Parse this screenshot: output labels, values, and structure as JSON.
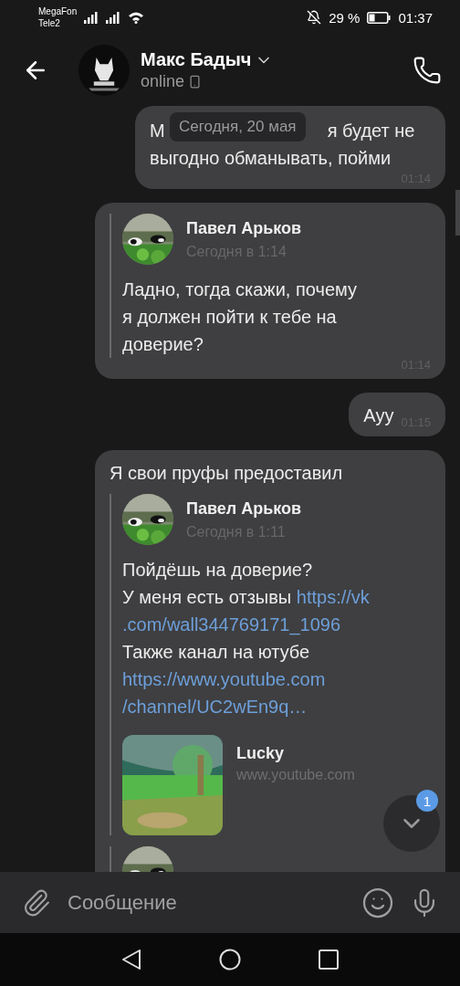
{
  "status_bar": {
    "carriers": [
      "MegaFon",
      "Tele2"
    ],
    "battery": "29 %",
    "time": "01:37"
  },
  "header": {
    "name": "Макс Бадыч",
    "status": "online"
  },
  "date_pill": "Сегодня, 20 мая",
  "messages": [
    {
      "kind": "text",
      "hidden_start": "М",
      "lines": [
        "я будет не",
        "выгодно обманывать, пойми"
      ],
      "time": "01:14"
    },
    {
      "kind": "forward",
      "time": "01:14",
      "forwards": [
        {
          "author": "Павел Арьков",
          "date": "Сегодня в 1:14",
          "lines": [
            [
              {
                "kind": "text",
                "text": "Ладно, тогда скажи, почему"
              }
            ],
            [
              {
                "kind": "text",
                "text": "я должен пойти к тебе на"
              }
            ],
            [
              {
                "kind": "text",
                "text": "доверие?"
              }
            ]
          ]
        }
      ]
    },
    {
      "kind": "short",
      "lines": [
        "Ауу"
      ],
      "time": "01:15"
    },
    {
      "kind": "forward",
      "text": "Я свои пруфы предоставил",
      "forwards": [
        {
          "author": "Павел Арьков",
          "date": "Сегодня в 1:11",
          "lines": [
            [
              {
                "kind": "text",
                "text": "Пойдёшь на доверие?"
              }
            ],
            [
              {
                "kind": "text",
                "text": "У меня есть отзывы "
              },
              {
                "kind": "link",
                "text": "https://vk"
              }
            ],
            [
              {
                "kind": "link",
                "text": ".com/wall344769171_1096"
              }
            ],
            [
              {
                "kind": "text",
                "text": "Также канал на ютубе"
              }
            ],
            [
              {
                "kind": "link",
                "text": "https://www.youtube.com"
              }
            ],
            [
              {
                "kind": "link",
                "text": "/channel/UC2wEn9q…"
              }
            ]
          ],
          "preview": {
            "title": "Lucky",
            "domain": "www.youtube.com"
          }
        },
        {
          "avatar": true
        }
      ]
    }
  ],
  "scroll_down": {
    "badge": "1"
  },
  "composer": {
    "placeholder": "Сообщение"
  }
}
